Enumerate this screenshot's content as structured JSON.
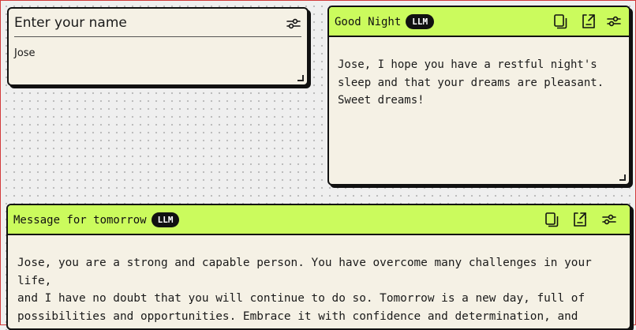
{
  "name_input": {
    "title": "Enter your name",
    "value": "Jose"
  },
  "good_night": {
    "title": "Good Night",
    "badge": "LLM",
    "text": "Jose, I hope you have a restful night's\nsleep and that your dreams are pleasant.\nSweet dreams!"
  },
  "tomorrow": {
    "title": "Message for tomorrow",
    "badge": "LLM",
    "text": "Jose, you are a strong and capable person. You have overcome many challenges in your life,\nand I have no doubt that you will continue to do so. Tomorrow is a new day, full of\npossibilities and opportunities. Embrace it with confidence and determination, and\nremember that I believe in you."
  },
  "icons": {
    "settings": "sliders-icon",
    "copy": "copy-icon",
    "export": "export-icon"
  },
  "colors": {
    "accent": "#cbfb5d",
    "card_bg": "#f5f1e5",
    "border": "#111111",
    "badge_bg": "#111111"
  }
}
